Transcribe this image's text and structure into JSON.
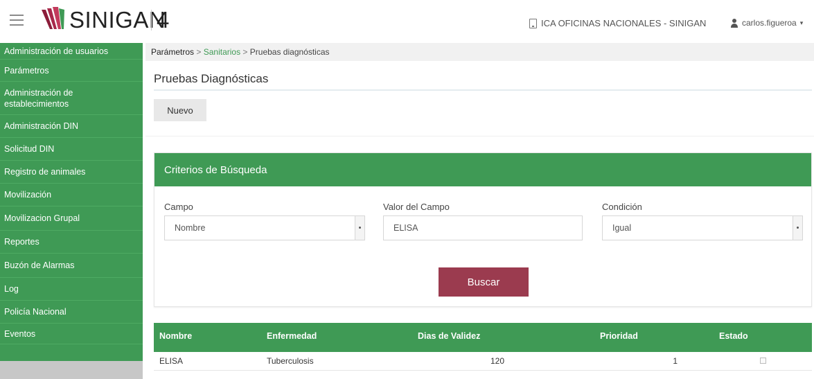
{
  "header": {
    "brand": "SINIGAN",
    "version": "4",
    "office": "ICA OFICINAS NACIONALES - SINIGAN",
    "user": "carlos.figueroa"
  },
  "sidebar": {
    "items": [
      "Administración de usuarios",
      "Parámetros",
      "Administración de establecimientos",
      "Administración DIN",
      "Solicitud DIN",
      "Registro de animales",
      "Movilización",
      "Movilizacion Grupal",
      "Reportes",
      "Buzón de Alarmas",
      "Log",
      "Policía Nacional",
      "Eventos"
    ]
  },
  "breadcrumb": {
    "root": "Parámetros",
    "sep1": " > ",
    "middle": "Sanitarios",
    "sep2": " > ",
    "current": "Pruebas diagnósticas"
  },
  "page": {
    "title": "Pruebas Diagnósticas",
    "new_button": "Nuevo"
  },
  "search": {
    "header": "Criterios de Búsqueda",
    "campo_label": "Campo",
    "campo_value": "Nombre",
    "valor_label": "Valor del Campo",
    "valor_value": "ELISA",
    "condicion_label": "Condición",
    "condicion_value": "Igual",
    "button": "Buscar"
  },
  "table": {
    "headers": [
      "Nombre",
      "Enfermedad",
      "Dias de Validez",
      "Prioridad",
      "Estado"
    ],
    "rows": [
      {
        "nombre": "ELISA",
        "enfermedad": "Tuberculosis",
        "dias": "120",
        "prioridad": "1"
      }
    ]
  },
  "colors": {
    "primary_green": "#3f9a55",
    "search_button": "#9b3b4f"
  }
}
